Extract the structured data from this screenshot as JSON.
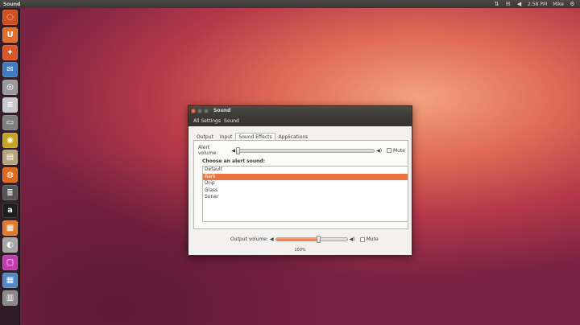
{
  "top_panel": {
    "title": "Sound",
    "tray": {
      "network_icon": "network-icon",
      "mail_icon": "mail-icon",
      "volume_icon": "volume-icon",
      "time": "2:58 PM",
      "user": "Mike",
      "session_icon": "power-icon"
    }
  },
  "launcher": {
    "items": [
      {
        "name": "ubuntu-dash-icon",
        "color": "#d44e1c",
        "glyph": "◌"
      },
      {
        "name": "files-icon",
        "color": "#e16f2c",
        "glyph": "U"
      },
      {
        "name": "firefox-icon",
        "color": "#d9562b",
        "glyph": "✦"
      },
      {
        "name": "thunderbird-icon",
        "color": "#3f7bc0",
        "glyph": "✉"
      },
      {
        "name": "disk-icon",
        "color": "#9a9a9a",
        "glyph": "◎"
      },
      {
        "name": "document-icon",
        "color": "#c9c9c9",
        "glyph": "≡"
      },
      {
        "name": "monitor-icon",
        "color": "#7f7f7f",
        "glyph": "▭"
      },
      {
        "name": "rhythmbox-icon",
        "color": "#c6a325",
        "glyph": "◉"
      },
      {
        "name": "archive-icon",
        "color": "#b7a37d",
        "glyph": "▤"
      },
      {
        "name": "chromium-icon",
        "color": "#e0691e",
        "glyph": "◍"
      },
      {
        "name": "software-center-icon",
        "color": "#555555",
        "glyph": "≣"
      },
      {
        "name": "amazon-icon",
        "color": "#1f1f1f",
        "glyph": "a"
      },
      {
        "name": "install-icon",
        "color": "#e07a2f",
        "glyph": "▦"
      },
      {
        "name": "sound-settings-icon",
        "color": "#a6a6a6",
        "glyph": "◐"
      },
      {
        "name": "window-app-icon",
        "color": "#c43ab1",
        "glyph": "▢"
      },
      {
        "name": "workspace-icon",
        "color": "#4f89c7",
        "glyph": "▦"
      },
      {
        "name": "trash-icon",
        "color": "#8a8a8a",
        "glyph": "▥"
      }
    ]
  },
  "window": {
    "title": "Sound",
    "toolbar": {
      "all_settings": "All Settings",
      "current": "Sound"
    },
    "tabs": [
      {
        "label": "Output",
        "active": false
      },
      {
        "label": "Input",
        "active": false
      },
      {
        "label": "Sound Effects",
        "active": true
      },
      {
        "label": "Applications",
        "active": false
      }
    ],
    "alert_volume": {
      "label": "Alert volume:",
      "mute_label": "Mute",
      "muted": false,
      "level": 0
    },
    "choose_label": "Choose an alert sound:",
    "sounds": [
      {
        "label": "Default",
        "selected": false
      },
      {
        "label": "Bark",
        "selected": true
      },
      {
        "label": "Drip",
        "selected": false
      },
      {
        "label": "Glass",
        "selected": false
      },
      {
        "label": "Sonar",
        "selected": false
      }
    ],
    "output_volume": {
      "label": "Output volume:",
      "mute_label": "Mute",
      "muted": false,
      "level": 0.6,
      "percent_text": "100%"
    }
  },
  "colors": {
    "accent": "#e9743f",
    "panel_bg": "#3c3b37"
  }
}
